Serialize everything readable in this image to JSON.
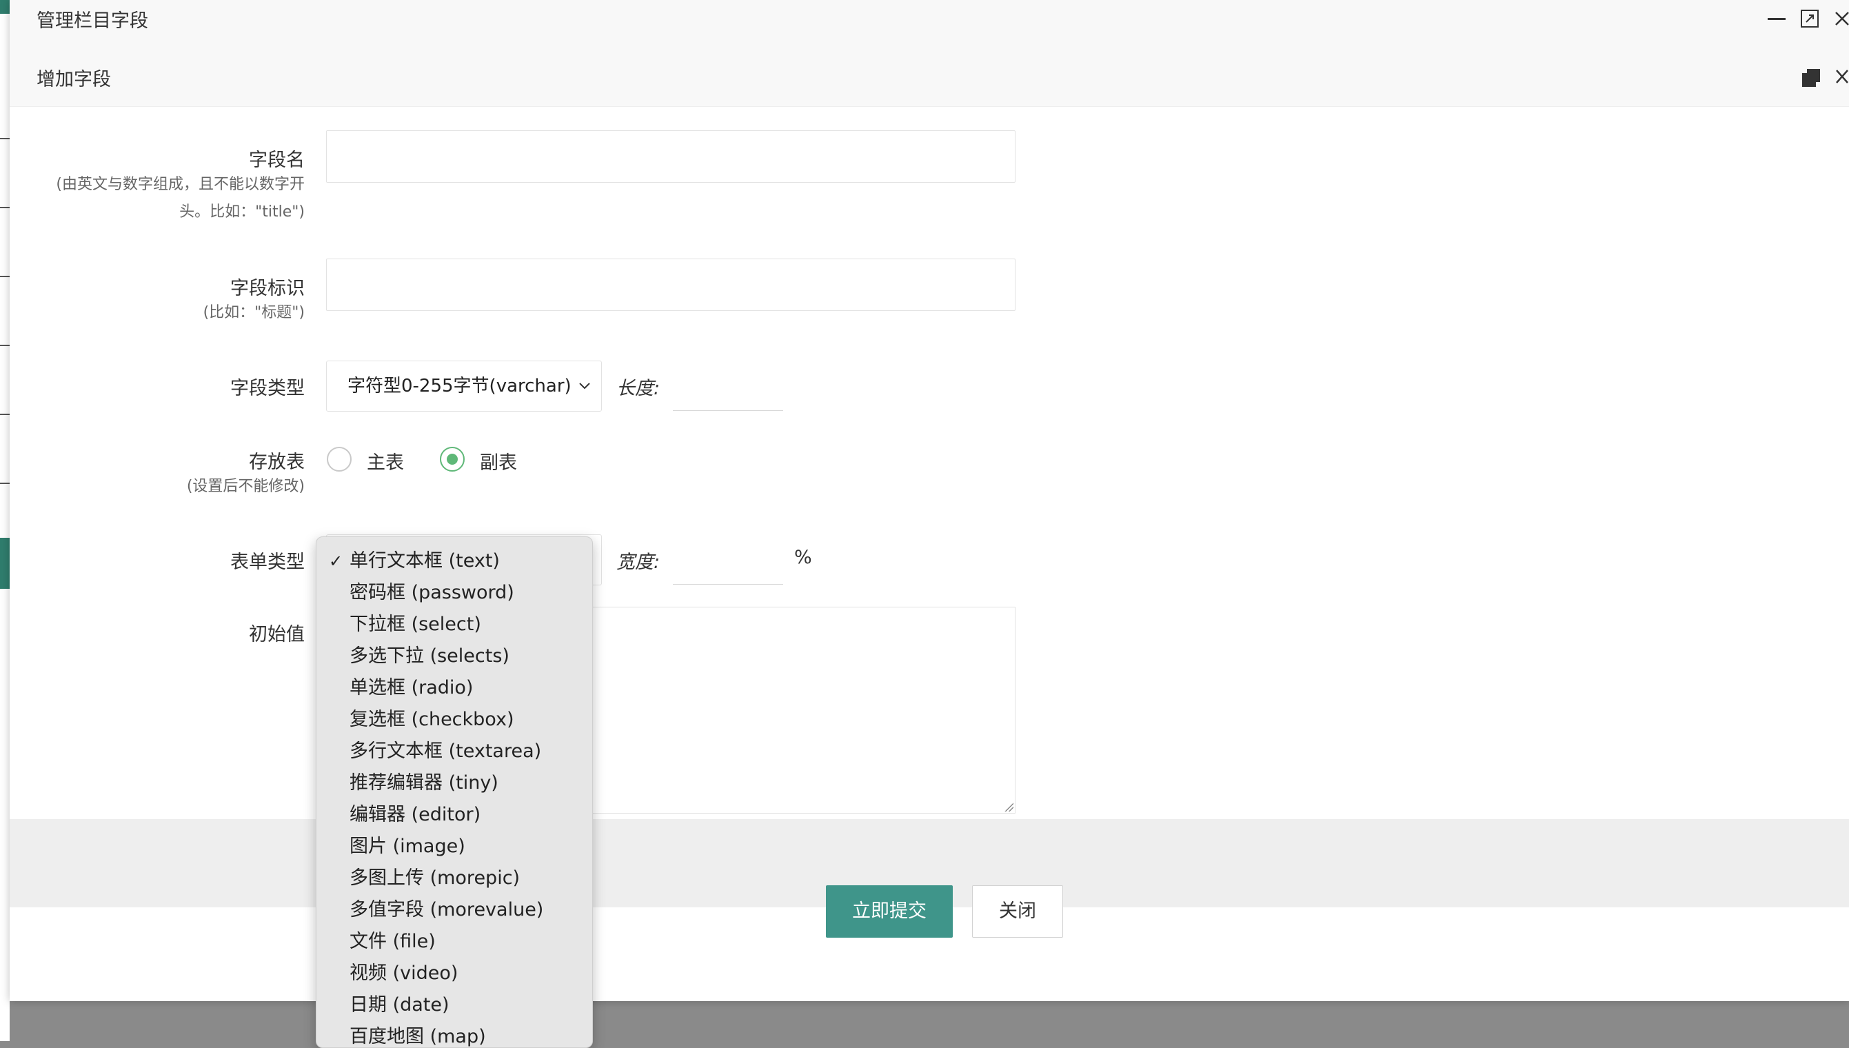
{
  "outer_dialog": {
    "title": "管理栏目字段",
    "minimize_icon": "minimize-icon",
    "maximize_icon": "maximize-icon",
    "close_icon": "close-icon"
  },
  "inner_dialog": {
    "title": "增加字段",
    "restore_icon": "restore-icon",
    "close_icon": "close-icon"
  },
  "form": {
    "field_name": {
      "label": "字段名",
      "hint_line1": "(由英文与数字组成，且不能以数字开",
      "hint_line2": "头。比如：\"title\")",
      "value": ""
    },
    "field_title": {
      "label": "字段标识",
      "hint": "(比如：\"标题\")",
      "value": ""
    },
    "field_type": {
      "label": "字段类型",
      "selected": "字符型0-255字节(varchar)",
      "length_label": "长度:",
      "length_value": ""
    },
    "storage_table": {
      "label": "存放表",
      "hint": "(设置后不能修改)",
      "options": [
        "主表",
        "副表"
      ],
      "selected": "副表"
    },
    "form_type": {
      "label": "表单类型",
      "width_label": "宽度:",
      "width_value": "",
      "width_unit": "%"
    },
    "default_value": {
      "label": "初始值",
      "value": ""
    }
  },
  "footer": {
    "submit_label": "立即提交",
    "close_label": "关闭"
  },
  "dropdown": {
    "checkmark": "✓",
    "options": [
      "单行文本框 (text)",
      "密码框 (password)",
      "下拉框 (select)",
      "多选下拉 (selects)",
      "单选框 (radio)",
      "复选框 (checkbox)",
      "多行文本框 (textarea)",
      "推荐编辑器 (tiny)",
      "编辑器 (editor)",
      "图片 (image)",
      "多图上传 (morepic)",
      "多值字段 (morevalue)",
      "文件 (file)",
      "视频 (video)",
      "日期 (date)",
      "百度地图 (map)"
    ],
    "selected_index": 0
  },
  "colors": {
    "primary": "#3f958a",
    "radio_on": "#5fb878"
  }
}
